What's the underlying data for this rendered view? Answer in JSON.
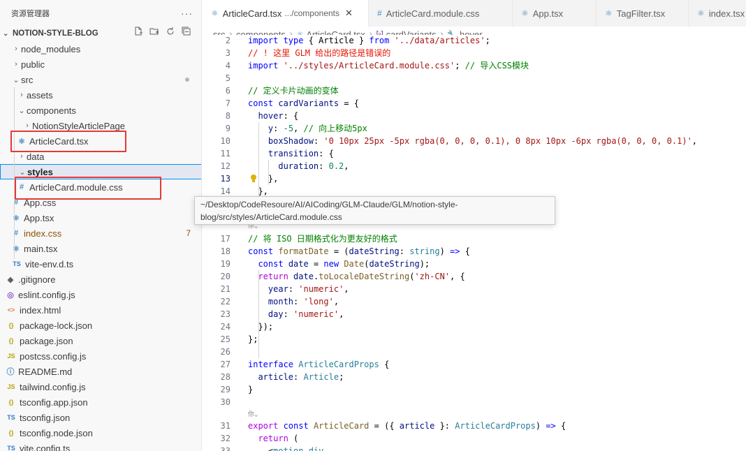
{
  "sidebar": {
    "title": "资源管理器",
    "more": "···",
    "project": "NOTION-STYLE-BLOG",
    "tree": [
      {
        "label": "node_modules",
        "chev": "›",
        "icon": "",
        "color": "#3b3b3b"
      },
      {
        "label": "public",
        "chev": "›",
        "icon": "",
        "color": "#3b3b3b"
      },
      {
        "label": "src",
        "chev": "⌄",
        "icon": "",
        "color": "#3b3b3b"
      },
      {
        "label": "assets",
        "chev": "›",
        "icon": "",
        "color": "#3b3b3b"
      },
      {
        "label": "components",
        "chev": "⌄",
        "icon": "",
        "color": "#3b3b3b"
      },
      {
        "label": "NotionStyleArticlePage",
        "chev": "›",
        "icon": "",
        "color": "#3b3b3b"
      },
      {
        "label": "ArticleCard.tsx",
        "chev": "",
        "icon": "⚛",
        "color": "#3b3b3b"
      },
      {
        "label": "data",
        "chev": "›",
        "icon": "",
        "color": "#3b3b3b"
      },
      {
        "label": "styles",
        "chev": "⌄",
        "icon": "",
        "color": "#3b3b3b"
      },
      {
        "label": "ArticleCard.module.css",
        "chev": "",
        "icon": "#",
        "color": "#3b3b3b"
      },
      {
        "label": "App.css",
        "chev": "",
        "icon": "#",
        "color": "#3b3b3b"
      },
      {
        "label": "App.tsx",
        "chev": "",
        "icon": "⚛",
        "color": "#3b3b3b"
      },
      {
        "label": "index.css",
        "chev": "",
        "icon": "#",
        "color": "#895503"
      },
      {
        "label": "main.tsx",
        "chev": "",
        "icon": "⚛",
        "color": "#3b3b3b"
      },
      {
        "label": "vite-env.d.ts",
        "chev": "",
        "icon": "TS",
        "color": "#3b3b3b"
      },
      {
        "label": ".gitignore",
        "chev": "",
        "icon": "◆",
        "color": "#3b3b3b"
      },
      {
        "label": "eslint.config.js",
        "chev": "",
        "icon": "◎",
        "color": "#3b3b3b"
      },
      {
        "label": "index.html",
        "chev": "",
        "icon": "<>",
        "color": "#3b3b3b"
      },
      {
        "label": "package-lock.json",
        "chev": "",
        "icon": "{}",
        "color": "#3b3b3b"
      },
      {
        "label": "package.json",
        "chev": "",
        "icon": "{}",
        "color": "#3b3b3b"
      },
      {
        "label": "postcss.config.js",
        "chev": "",
        "icon": "JS",
        "color": "#3b3b3b"
      },
      {
        "label": "README.md",
        "chev": "",
        "icon": "ⓘ",
        "color": "#3b3b3b"
      },
      {
        "label": "tailwind.config.js",
        "chev": "",
        "icon": "JS",
        "color": "#3b3b3b"
      },
      {
        "label": "tsconfig.app.json",
        "chev": "",
        "icon": "{}",
        "color": "#3b3b3b"
      },
      {
        "label": "tsconfig.json",
        "chev": "",
        "icon": "TS",
        "color": "#3b3b3b"
      },
      {
        "label": "tsconfig.node.json",
        "chev": "",
        "icon": "{}",
        "color": "#3b3b3b"
      },
      {
        "label": "vite.config.ts",
        "chev": "",
        "icon": "TS",
        "color": "#3b3b3b"
      }
    ],
    "index_css_badge": "7"
  },
  "tabs": [
    {
      "label": "ArticleCard.tsx",
      "desc": ".../components",
      "icon": "⚛",
      "close": "✕",
      "active": true
    },
    {
      "label": "ArticleCard.module.css",
      "desc": "",
      "icon": "#",
      "close": "",
      "active": false
    },
    {
      "label": "App.tsx",
      "desc": "",
      "icon": "⚛",
      "close": "",
      "active": false
    },
    {
      "label": "TagFilter.tsx",
      "desc": "",
      "icon": "⚛",
      "close": "",
      "active": false
    },
    {
      "label": "index.tsx",
      "desc": "",
      "icon": "⚛",
      "close": "",
      "active": false
    }
  ],
  "breadcrumb": [
    "src",
    "components",
    "ArticleCard.tsx",
    "cardVariants",
    "hover"
  ],
  "tooltip": {
    "line1": "~/Desktop/CodeResoure/AI/AICoding/GLM-Claude/GLM/notion-style-",
    "line2": "blog/src/styles/ArticleCard.module.css"
  },
  "code_lines": [
    {
      "n": "2",
      "parts": [
        [
          "k",
          "import type "
        ],
        [
          "",
          "{ Article } "
        ],
        [
          "k",
          "from "
        ],
        [
          "s",
          "'../data/articles'"
        ],
        [
          "",
          ";"
        ]
      ]
    },
    {
      "n": "3",
      "parts": [
        [
          "cr",
          "// ! 这里 GLM 给出的路径是错误的"
        ]
      ]
    },
    {
      "n": "4",
      "parts": [
        [
          "k",
          "import "
        ],
        [
          "s",
          "'../styles/ArticleCard.module.css'"
        ],
        [
          "",
          "; "
        ],
        [
          "c",
          "// 导入CSS模块"
        ]
      ]
    },
    {
      "n": "5",
      "parts": []
    },
    {
      "n": "6",
      "parts": [
        [
          "c",
          "// 定义卡片动画的变体"
        ]
      ]
    },
    {
      "n": "7",
      "parts": [
        [
          "k",
          "const "
        ],
        [
          "v",
          "cardVariants"
        ],
        [
          "",
          " = {"
        ]
      ]
    },
    {
      "n": "8",
      "parts": [
        [
          "",
          "  "
        ],
        [
          "v",
          "hover"
        ],
        [
          "",
          ": {"
        ]
      ]
    },
    {
      "n": "9",
      "parts": [
        [
          "",
          "    "
        ],
        [
          "v",
          "y"
        ],
        [
          "",
          ": "
        ],
        [
          "n",
          "-5"
        ],
        [
          "",
          ", "
        ],
        [
          "c",
          "// 向上移动5px"
        ]
      ]
    },
    {
      "n": "10",
      "parts": [
        [
          "",
          "    "
        ],
        [
          "v",
          "boxShadow"
        ],
        [
          "",
          ": "
        ],
        [
          "s",
          "'0 10px 25px -5px rgba(0, 0, 0, 0.1), 0 8px 10px -6px rgba(0, 0, 0, 0.1)'"
        ],
        [
          "",
          ","
        ]
      ]
    },
    {
      "n": "11",
      "parts": [
        [
          "",
          "    "
        ],
        [
          "v",
          "transition"
        ],
        [
          "",
          ": {"
        ]
      ]
    },
    {
      "n": "12",
      "parts": [
        [
          "",
          "      "
        ],
        [
          "v",
          "duration"
        ],
        [
          "",
          ": "
        ],
        [
          "n",
          "0.2"
        ],
        [
          "",
          ","
        ]
      ]
    },
    {
      "n": "13",
      "parts": [
        [
          "",
          "    },"
        ]
      ]
    },
    {
      "n": "14",
      "parts": [
        [
          "",
          "  },"
        ]
      ]
    },
    {
      "n": "17",
      "parts": [
        [
          "c",
          "// 将 ISO 日期格式化为更友好的格式"
        ]
      ]
    },
    {
      "n": "18",
      "parts": [
        [
          "k",
          "const "
        ],
        [
          "f",
          "formatDate"
        ],
        [
          "",
          " = ("
        ],
        [
          "v",
          "dateString"
        ],
        [
          "",
          ": "
        ],
        [
          "t",
          "string"
        ],
        [
          "",
          ") "
        ],
        [
          "k",
          "=> "
        ],
        [
          "",
          "{"
        ]
      ]
    },
    {
      "n": "19",
      "parts": [
        [
          "",
          "  "
        ],
        [
          "k",
          "const "
        ],
        [
          "v",
          "date"
        ],
        [
          "",
          " = "
        ],
        [
          "k",
          "new "
        ],
        [
          "f",
          "Date"
        ],
        [
          "",
          "("
        ],
        [
          "v",
          "dateString"
        ],
        [
          "",
          ");"
        ]
      ]
    },
    {
      "n": "20",
      "parts": [
        [
          "",
          "  "
        ],
        [
          "kw",
          "return "
        ],
        [
          "v",
          "date"
        ],
        [
          "",
          "."
        ],
        [
          "f",
          "toLocaleDateString"
        ],
        [
          "",
          "("
        ],
        [
          "s",
          "'zh-CN'"
        ],
        [
          "",
          ", {"
        ]
      ]
    },
    {
      "n": "21",
      "parts": [
        [
          "",
          "    "
        ],
        [
          "v",
          "year"
        ],
        [
          "",
          ": "
        ],
        [
          "s",
          "'numeric'"
        ],
        [
          "",
          ","
        ]
      ]
    },
    {
      "n": "22",
      "parts": [
        [
          "",
          "    "
        ],
        [
          "v",
          "month"
        ],
        [
          "",
          ": "
        ],
        [
          "s",
          "'long'"
        ],
        [
          "",
          ","
        ]
      ]
    },
    {
      "n": "23",
      "parts": [
        [
          "",
          "    "
        ],
        [
          "v",
          "day"
        ],
        [
          "",
          ": "
        ],
        [
          "s",
          "'numeric'"
        ],
        [
          "",
          ","
        ]
      ]
    },
    {
      "n": "24",
      "parts": [
        [
          "",
          "  });"
        ]
      ]
    },
    {
      "n": "25",
      "parts": [
        [
          "",
          "};"
        ]
      ]
    },
    {
      "n": "26",
      "parts": []
    },
    {
      "n": "27",
      "parts": [
        [
          "k",
          "interface "
        ],
        [
          "t",
          "ArticleCardProps "
        ],
        [
          "",
          "{"
        ]
      ]
    },
    {
      "n": "28",
      "parts": [
        [
          "",
          "  "
        ],
        [
          "v",
          "article"
        ],
        [
          "",
          ": "
        ],
        [
          "t",
          "Article"
        ],
        [
          "",
          ";"
        ]
      ]
    },
    {
      "n": "29",
      "parts": [
        [
          "",
          "}"
        ]
      ]
    },
    {
      "n": "30",
      "parts": []
    },
    {
      "n": "31",
      "parts": [
        [
          "kw",
          "export "
        ],
        [
          "k",
          "const "
        ],
        [
          "f",
          "ArticleCard"
        ],
        [
          "",
          " = ({ "
        ],
        [
          "v",
          "article"
        ],
        [
          "",
          " }: "
        ],
        [
          "t",
          "ArticleCardProps"
        ],
        [
          "",
          ") "
        ],
        [
          "k",
          "=> "
        ],
        [
          "",
          "{"
        ]
      ]
    },
    {
      "n": "32",
      "parts": [
        [
          "",
          "  "
        ],
        [
          "kw",
          "return "
        ],
        [
          "",
          "("
        ]
      ]
    },
    {
      "n": "33",
      "parts": [
        [
          "",
          "    <"
        ],
        [
          "t",
          "motion.div"
        ]
      ]
    }
  ],
  "codelens_hint": "你"
}
